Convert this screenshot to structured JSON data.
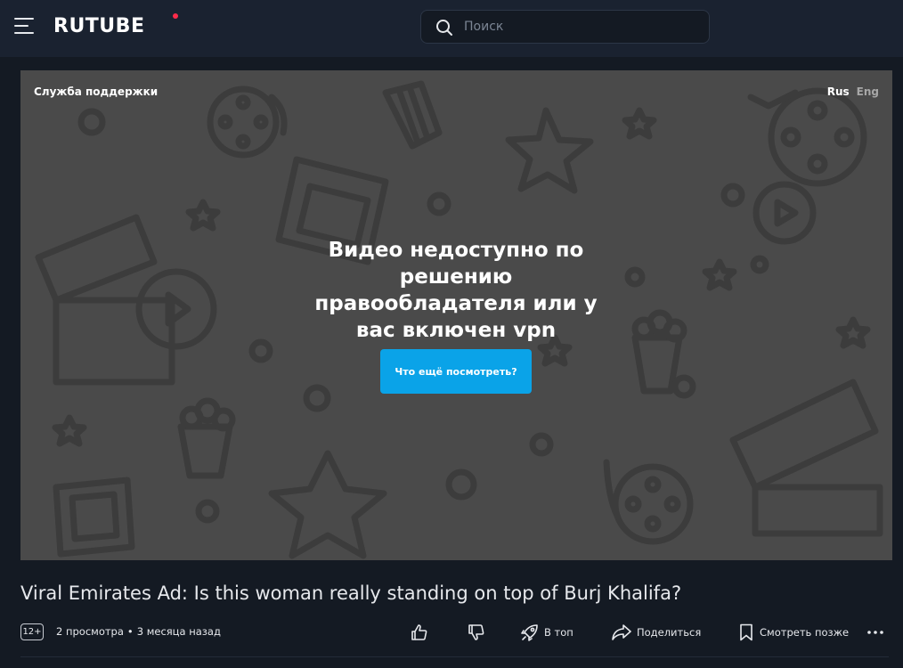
{
  "header": {
    "logo_text": "RUTUBE",
    "search": {
      "placeholder": "Поиск"
    }
  },
  "player": {
    "support_label": "Служба поддержки",
    "lang_rus": "Rus",
    "lang_eng": "Eng",
    "message": "Видео недоступно по решению правообладателя или у вас включен vpn",
    "button_label": "Что ещё посмотреть?"
  },
  "video": {
    "title": "Viral Emirates Ad: Is this woman really standing on top of Burj Khalifa?",
    "age_rating": "12+",
    "views": "2 просмотра",
    "separator": "•",
    "published": "3 месяца назад"
  },
  "actions": {
    "top_label": "В топ",
    "share_label": "Поделиться",
    "watch_later_label": "Смотреть позже"
  },
  "colors": {
    "background": "#141a23",
    "header": "#1a2230",
    "accent_button": "#0aa3e8",
    "logo_dot": "#ff2b4a",
    "player_bg": "#4a4a4a"
  },
  "icons": [
    "menu-icon",
    "search-icon",
    "like-icon",
    "dislike-icon",
    "rocket-icon",
    "share-icon",
    "bookmark-icon",
    "more-icon"
  ]
}
